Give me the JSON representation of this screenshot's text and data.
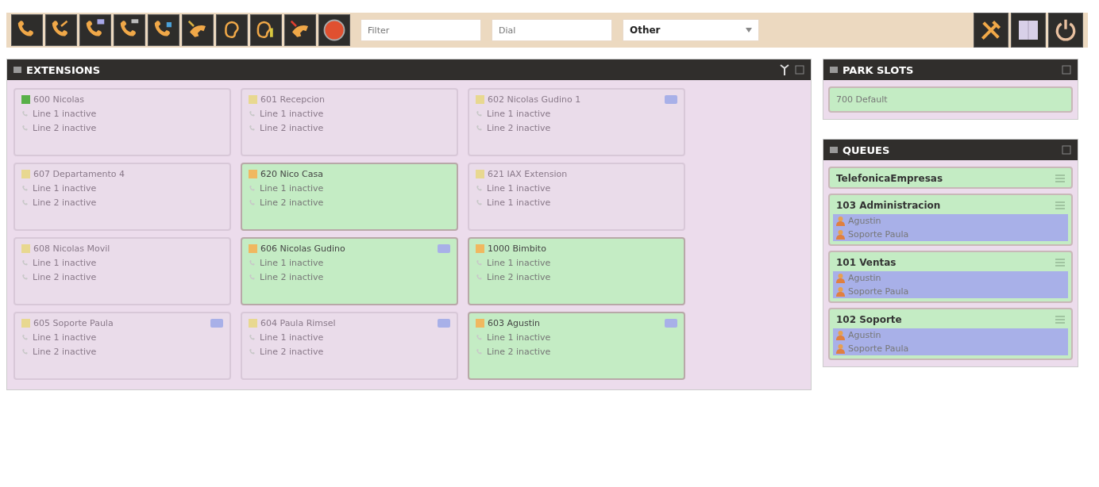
{
  "toolbar": {
    "filter": {
      "placeholder": "Filter"
    },
    "dial": {
      "placeholder": "Dial"
    },
    "select": {
      "value": "Other"
    }
  },
  "extensions": {
    "title": "EXTENSIONS",
    "items": [
      {
        "name": "600 Nicolas",
        "lines": [
          "Line 1 inactive",
          "Line 2 inactive"
        ],
        "active": false,
        "mail": false,
        "color": "#58b048"
      },
      {
        "name": "601 Recepcion",
        "lines": [
          "Line 1 inactive",
          "Line 2 inactive"
        ],
        "active": false,
        "mail": false,
        "color": "#e8d890"
      },
      {
        "name": "602 Nicolas Gudino 1",
        "lines": [
          "Line 1 inactive",
          "Line 2 inactive"
        ],
        "active": false,
        "mail": true,
        "color": "#e8d890"
      },
      {
        "name": "607 Departamento 4",
        "lines": [
          "Line 1 inactive",
          "Line 2 inactive"
        ],
        "active": false,
        "mail": false,
        "color": "#e8d890"
      },
      {
        "name": "620 Nico Casa",
        "lines": [
          "Line 1 inactive",
          "Line 2 inactive"
        ],
        "active": true,
        "mail": false,
        "color": "#f0b860"
      },
      {
        "name": "621 IAX Extension",
        "lines": [
          "Line 1 inactive",
          "Line 1 inactive"
        ],
        "active": false,
        "mail": false,
        "color": "#e8d890"
      },
      {
        "name": "608 Nicolas Movil",
        "lines": [
          "Line 1 inactive",
          "Line 2 inactive"
        ],
        "active": false,
        "mail": false,
        "color": "#e8d890"
      },
      {
        "name": "606 Nicolas Gudino",
        "lines": [
          "Line 1 inactive",
          "Line 2 inactive"
        ],
        "active": true,
        "mail": true,
        "color": "#f0b860"
      },
      {
        "name": "1000 Bimbito",
        "lines": [
          "Line 1 inactive",
          "Line 2 inactive"
        ],
        "active": true,
        "mail": false,
        "color": "#f0b860"
      },
      {
        "name": "605 Soporte Paula",
        "lines": [
          "Line 1 inactive",
          "Line 2 inactive"
        ],
        "active": false,
        "mail": true,
        "color": "#e8d890"
      },
      {
        "name": "604 Paula Rimsel",
        "lines": [
          "Line 1 inactive",
          "Line 2 inactive"
        ],
        "active": false,
        "mail": true,
        "color": "#e8d890"
      },
      {
        "name": "603 Agustin",
        "lines": [
          "Line 1 inactive",
          "Line 2 inactive"
        ],
        "active": true,
        "mail": true,
        "color": "#f0b860"
      }
    ]
  },
  "park_slots": {
    "title": "PARK SLOTS",
    "items": [
      "700 Default"
    ]
  },
  "queues": {
    "title": "QUEUES",
    "items": [
      {
        "name": "TelefonicaEmpresas"
      },
      {
        "name": "103 Administracion",
        "members": [
          "Agustin",
          "Soporte Paula"
        ]
      },
      {
        "name": "101 Ventas",
        "members": [
          "Agustin",
          "Soporte Paula"
        ]
      },
      {
        "name": "102 Soporte",
        "members": [
          "Agustin",
          "Soporte Paula"
        ]
      }
    ]
  }
}
